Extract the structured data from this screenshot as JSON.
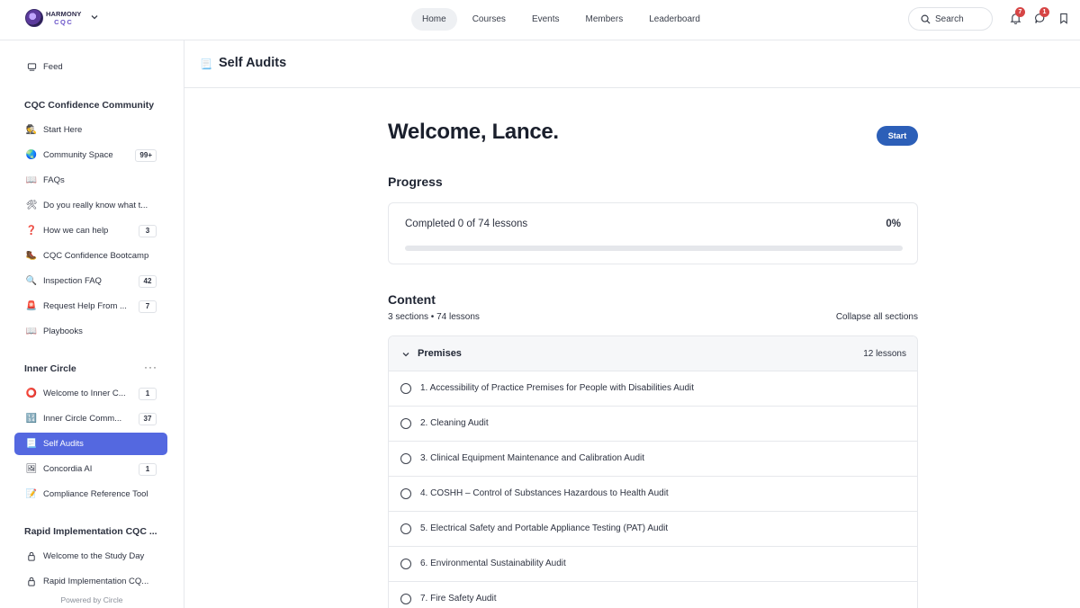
{
  "brand": {
    "line1": "HARMONY",
    "line2": "CQC"
  },
  "topnav": [
    {
      "label": "Home",
      "active": true
    },
    {
      "label": "Courses"
    },
    {
      "label": "Events"
    },
    {
      "label": "Members"
    },
    {
      "label": "Leaderboard"
    }
  ],
  "search": {
    "label": "Search"
  },
  "notifications": {
    "bell_count": "7",
    "chat_count": "1"
  },
  "sidebar": {
    "feed": {
      "icon": "feed-icon",
      "label": "Feed"
    },
    "group1": {
      "heading": "CQC Confidence Community",
      "items": [
        {
          "icon": "🕵",
          "label": "Start Here",
          "count": ""
        },
        {
          "icon": "🌏",
          "label": "Community Space",
          "count": "99+"
        },
        {
          "icon": "📖",
          "label": "FAQs",
          "count": ""
        },
        {
          "icon": "🛠",
          "label": "Do you really know what t...",
          "count": ""
        },
        {
          "icon": "❓",
          "label": "How we can help",
          "count": "3"
        },
        {
          "icon": "🥾",
          "label": "CQC Confidence Bootcamp",
          "count": ""
        },
        {
          "icon": "🔍",
          "label": "Inspection FAQ",
          "count": "42"
        },
        {
          "icon": "🚨",
          "label": "Request Help From ...",
          "count": "7"
        },
        {
          "icon": "📖",
          "label": "Playbooks",
          "count": ""
        }
      ]
    },
    "group2": {
      "heading": "Inner Circle",
      "items": [
        {
          "icon": "⭕",
          "label": "Welcome to Inner C...",
          "count": "1"
        },
        {
          "icon": "🔢",
          "label": "Inner Circle Comm...",
          "count": "37"
        },
        {
          "icon": "📃",
          "label": "Self Audits",
          "count": "",
          "active": true
        },
        {
          "icon": "🖼",
          "label": "Concordia AI",
          "count": "1"
        },
        {
          "icon": "📝",
          "label": "Compliance Reference Tool",
          "count": ""
        }
      ]
    },
    "group3": {
      "heading": "Rapid Implementation CQC ...",
      "items": [
        {
          "icon": "lock-icon",
          "label": "Welcome to the Study Day"
        },
        {
          "icon": "lock-icon",
          "label": "Rapid Implementation CQ..."
        }
      ]
    },
    "powered_by": "Powered by Circle"
  },
  "page": {
    "title": "Self Audits",
    "icon": "📃"
  },
  "main": {
    "welcome": "Welcome, Lance.",
    "start_label": "Start",
    "progress_heading": "Progress",
    "progress_text": "Completed 0 of 74 lessons",
    "progress_pct": "0%",
    "progress_value": 0,
    "content_heading": "Content",
    "content_meta": "3 sections • 74 lessons",
    "collapse_label": "Collapse all sections",
    "section": {
      "title": "Premises",
      "count": "12 lessons",
      "lessons": [
        "1. Accessibility of Practice Premises for People with Disabilities Audit",
        "2. Cleaning Audit",
        "3. Clinical Equipment Maintenance and Calibration Audit",
        "4. COSHH – Control of Substances Hazardous to Health Audit",
        "5. Electrical Safety and Portable Appliance Testing (PAT) Audit",
        "6. Environmental Sustainability Audit",
        "7. Fire Safety Audit"
      ]
    }
  },
  "colors": {
    "accent": "#2c5fb8",
    "sidebar_active": "#5468e0",
    "badge": "#d64545"
  }
}
